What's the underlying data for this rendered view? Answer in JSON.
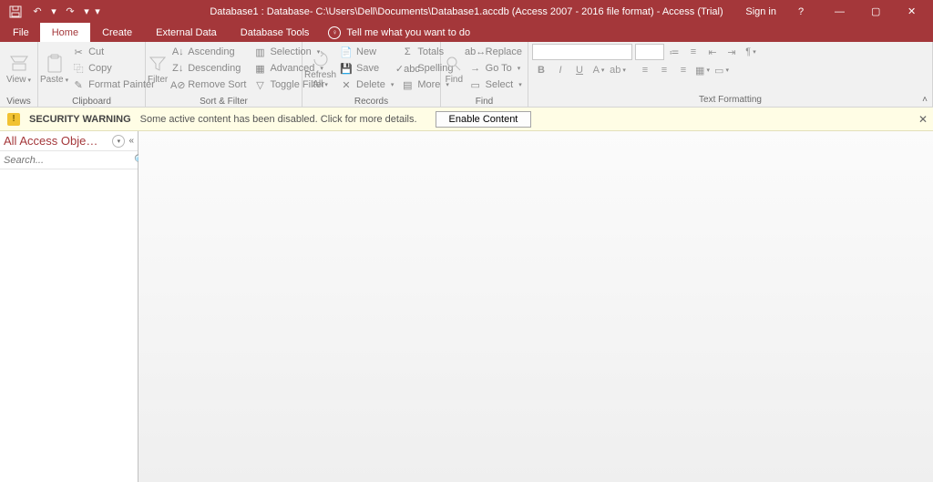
{
  "titlebar": {
    "title": "Database1 : Database- C:\\Users\\Dell\\Documents\\Database1.accdb (Access 2007 - 2016 file format) - Access (Trial)",
    "sign_in": "Sign in"
  },
  "tabs": {
    "file": "File",
    "home": "Home",
    "create": "Create",
    "external": "External Data",
    "dbtools": "Database Tools",
    "tellme": "Tell me what you want to do"
  },
  "ribbon": {
    "views": {
      "label": "Views",
      "view": "View"
    },
    "clipboard": {
      "label": "Clipboard",
      "paste": "Paste",
      "cut": "Cut",
      "copy": "Copy",
      "painter": "Format Painter"
    },
    "sortfilter": {
      "label": "Sort & Filter",
      "filter": "Filter",
      "asc": "Ascending",
      "desc": "Descending",
      "remove": "Remove Sort",
      "selection": "Selection",
      "advanced": "Advanced",
      "toggle": "Toggle Filter"
    },
    "records": {
      "label": "Records",
      "refresh": "Refresh\nAll",
      "new": "New",
      "save": "Save",
      "delete": "Delete",
      "totals": "Totals",
      "spelling": "Spelling",
      "more": "More"
    },
    "find": {
      "label": "Find",
      "find": "Find",
      "replace": "Replace",
      "goto": "Go To",
      "select": "Select"
    },
    "textfmt": {
      "label": "Text Formatting"
    }
  },
  "msgbar": {
    "title": "SECURITY WARNING",
    "text": "Some active content has been disabled. Click for more details.",
    "button": "Enable Content"
  },
  "navpane": {
    "title": "All Access Obje…",
    "search_placeholder": "Search..."
  }
}
